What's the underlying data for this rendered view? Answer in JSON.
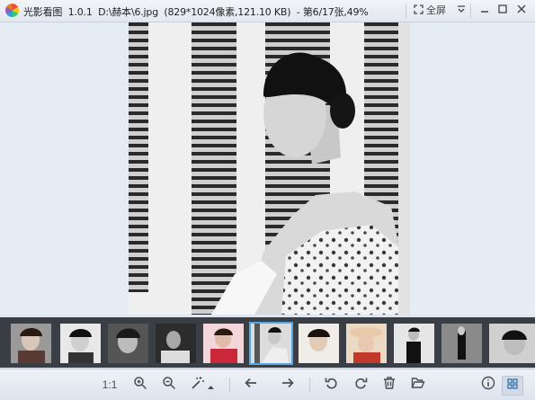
{
  "titlebar": {
    "app_name": "光影看图",
    "version": "1.0.1",
    "path": "D:\\赫本\\6.jpg",
    "info": "(829*1024像素,121.10 KB)",
    "position": "- 第6/17张,49%",
    "fullscreen_label": "全屏"
  },
  "thumbnails": [
    "thumb-1",
    "thumb-2",
    "thumb-3",
    "thumb-4",
    "thumb-5",
    "thumb-6",
    "thumb-7",
    "thumb-8",
    "thumb-9",
    "thumb-10",
    "thumb-11",
    "thumb-12"
  ],
  "selected_index": 6,
  "toolbar": {
    "actual_size_label": "1:1"
  }
}
